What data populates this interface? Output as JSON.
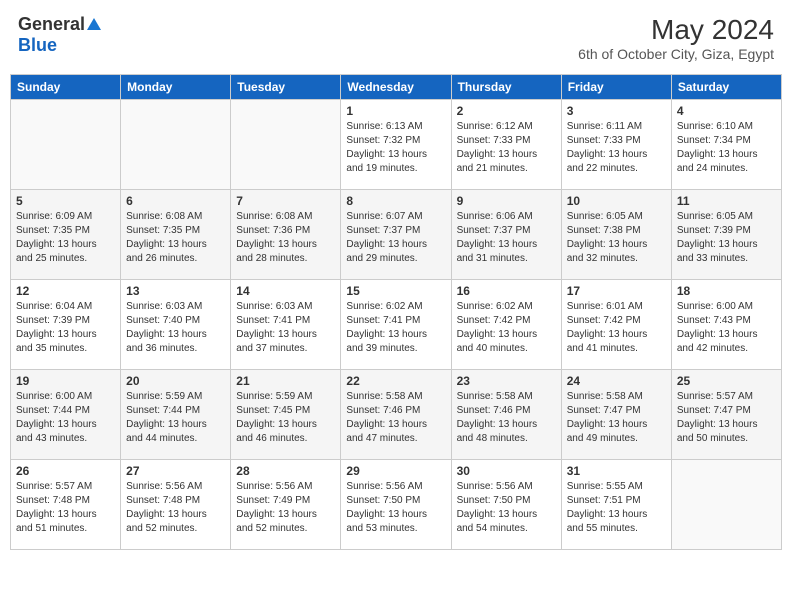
{
  "header": {
    "logo_general": "General",
    "logo_blue": "Blue",
    "month_year": "May 2024",
    "location": "6th of October City, Giza, Egypt"
  },
  "weekdays": [
    "Sunday",
    "Monday",
    "Tuesday",
    "Wednesday",
    "Thursday",
    "Friday",
    "Saturday"
  ],
  "weeks": [
    [
      {
        "day": "",
        "sunrise": "",
        "sunset": "",
        "daylight": ""
      },
      {
        "day": "",
        "sunrise": "",
        "sunset": "",
        "daylight": ""
      },
      {
        "day": "",
        "sunrise": "",
        "sunset": "",
        "daylight": ""
      },
      {
        "day": "1",
        "sunrise": "Sunrise: 6:13 AM",
        "sunset": "Sunset: 7:32 PM",
        "daylight": "Daylight: 13 hours and 19 minutes."
      },
      {
        "day": "2",
        "sunrise": "Sunrise: 6:12 AM",
        "sunset": "Sunset: 7:33 PM",
        "daylight": "Daylight: 13 hours and 21 minutes."
      },
      {
        "day": "3",
        "sunrise": "Sunrise: 6:11 AM",
        "sunset": "Sunset: 7:33 PM",
        "daylight": "Daylight: 13 hours and 22 minutes."
      },
      {
        "day": "4",
        "sunrise": "Sunrise: 6:10 AM",
        "sunset": "Sunset: 7:34 PM",
        "daylight": "Daylight: 13 hours and 24 minutes."
      }
    ],
    [
      {
        "day": "5",
        "sunrise": "Sunrise: 6:09 AM",
        "sunset": "Sunset: 7:35 PM",
        "daylight": "Daylight: 13 hours and 25 minutes."
      },
      {
        "day": "6",
        "sunrise": "Sunrise: 6:08 AM",
        "sunset": "Sunset: 7:35 PM",
        "daylight": "Daylight: 13 hours and 26 minutes."
      },
      {
        "day": "7",
        "sunrise": "Sunrise: 6:08 AM",
        "sunset": "Sunset: 7:36 PM",
        "daylight": "Daylight: 13 hours and 28 minutes."
      },
      {
        "day": "8",
        "sunrise": "Sunrise: 6:07 AM",
        "sunset": "Sunset: 7:37 PM",
        "daylight": "Daylight: 13 hours and 29 minutes."
      },
      {
        "day": "9",
        "sunrise": "Sunrise: 6:06 AM",
        "sunset": "Sunset: 7:37 PM",
        "daylight": "Daylight: 13 hours and 31 minutes."
      },
      {
        "day": "10",
        "sunrise": "Sunrise: 6:05 AM",
        "sunset": "Sunset: 7:38 PM",
        "daylight": "Daylight: 13 hours and 32 minutes."
      },
      {
        "day": "11",
        "sunrise": "Sunrise: 6:05 AM",
        "sunset": "Sunset: 7:39 PM",
        "daylight": "Daylight: 13 hours and 33 minutes."
      }
    ],
    [
      {
        "day": "12",
        "sunrise": "Sunrise: 6:04 AM",
        "sunset": "Sunset: 7:39 PM",
        "daylight": "Daylight: 13 hours and 35 minutes."
      },
      {
        "day": "13",
        "sunrise": "Sunrise: 6:03 AM",
        "sunset": "Sunset: 7:40 PM",
        "daylight": "Daylight: 13 hours and 36 minutes."
      },
      {
        "day": "14",
        "sunrise": "Sunrise: 6:03 AM",
        "sunset": "Sunset: 7:41 PM",
        "daylight": "Daylight: 13 hours and 37 minutes."
      },
      {
        "day": "15",
        "sunrise": "Sunrise: 6:02 AM",
        "sunset": "Sunset: 7:41 PM",
        "daylight": "Daylight: 13 hours and 39 minutes."
      },
      {
        "day": "16",
        "sunrise": "Sunrise: 6:02 AM",
        "sunset": "Sunset: 7:42 PM",
        "daylight": "Daylight: 13 hours and 40 minutes."
      },
      {
        "day": "17",
        "sunrise": "Sunrise: 6:01 AM",
        "sunset": "Sunset: 7:42 PM",
        "daylight": "Daylight: 13 hours and 41 minutes."
      },
      {
        "day": "18",
        "sunrise": "Sunrise: 6:00 AM",
        "sunset": "Sunset: 7:43 PM",
        "daylight": "Daylight: 13 hours and 42 minutes."
      }
    ],
    [
      {
        "day": "19",
        "sunrise": "Sunrise: 6:00 AM",
        "sunset": "Sunset: 7:44 PM",
        "daylight": "Daylight: 13 hours and 43 minutes."
      },
      {
        "day": "20",
        "sunrise": "Sunrise: 5:59 AM",
        "sunset": "Sunset: 7:44 PM",
        "daylight": "Daylight: 13 hours and 44 minutes."
      },
      {
        "day": "21",
        "sunrise": "Sunrise: 5:59 AM",
        "sunset": "Sunset: 7:45 PM",
        "daylight": "Daylight: 13 hours and 46 minutes."
      },
      {
        "day": "22",
        "sunrise": "Sunrise: 5:58 AM",
        "sunset": "Sunset: 7:46 PM",
        "daylight": "Daylight: 13 hours and 47 minutes."
      },
      {
        "day": "23",
        "sunrise": "Sunrise: 5:58 AM",
        "sunset": "Sunset: 7:46 PM",
        "daylight": "Daylight: 13 hours and 48 minutes."
      },
      {
        "day": "24",
        "sunrise": "Sunrise: 5:58 AM",
        "sunset": "Sunset: 7:47 PM",
        "daylight": "Daylight: 13 hours and 49 minutes."
      },
      {
        "day": "25",
        "sunrise": "Sunrise: 5:57 AM",
        "sunset": "Sunset: 7:47 PM",
        "daylight": "Daylight: 13 hours and 50 minutes."
      }
    ],
    [
      {
        "day": "26",
        "sunrise": "Sunrise: 5:57 AM",
        "sunset": "Sunset: 7:48 PM",
        "daylight": "Daylight: 13 hours and 51 minutes."
      },
      {
        "day": "27",
        "sunrise": "Sunrise: 5:56 AM",
        "sunset": "Sunset: 7:48 PM",
        "daylight": "Daylight: 13 hours and 52 minutes."
      },
      {
        "day": "28",
        "sunrise": "Sunrise: 5:56 AM",
        "sunset": "Sunset: 7:49 PM",
        "daylight": "Daylight: 13 hours and 52 minutes."
      },
      {
        "day": "29",
        "sunrise": "Sunrise: 5:56 AM",
        "sunset": "Sunset: 7:50 PM",
        "daylight": "Daylight: 13 hours and 53 minutes."
      },
      {
        "day": "30",
        "sunrise": "Sunrise: 5:56 AM",
        "sunset": "Sunset: 7:50 PM",
        "daylight": "Daylight: 13 hours and 54 minutes."
      },
      {
        "day": "31",
        "sunrise": "Sunrise: 5:55 AM",
        "sunset": "Sunset: 7:51 PM",
        "daylight": "Daylight: 13 hours and 55 minutes."
      },
      {
        "day": "",
        "sunrise": "",
        "sunset": "",
        "daylight": ""
      }
    ]
  ]
}
